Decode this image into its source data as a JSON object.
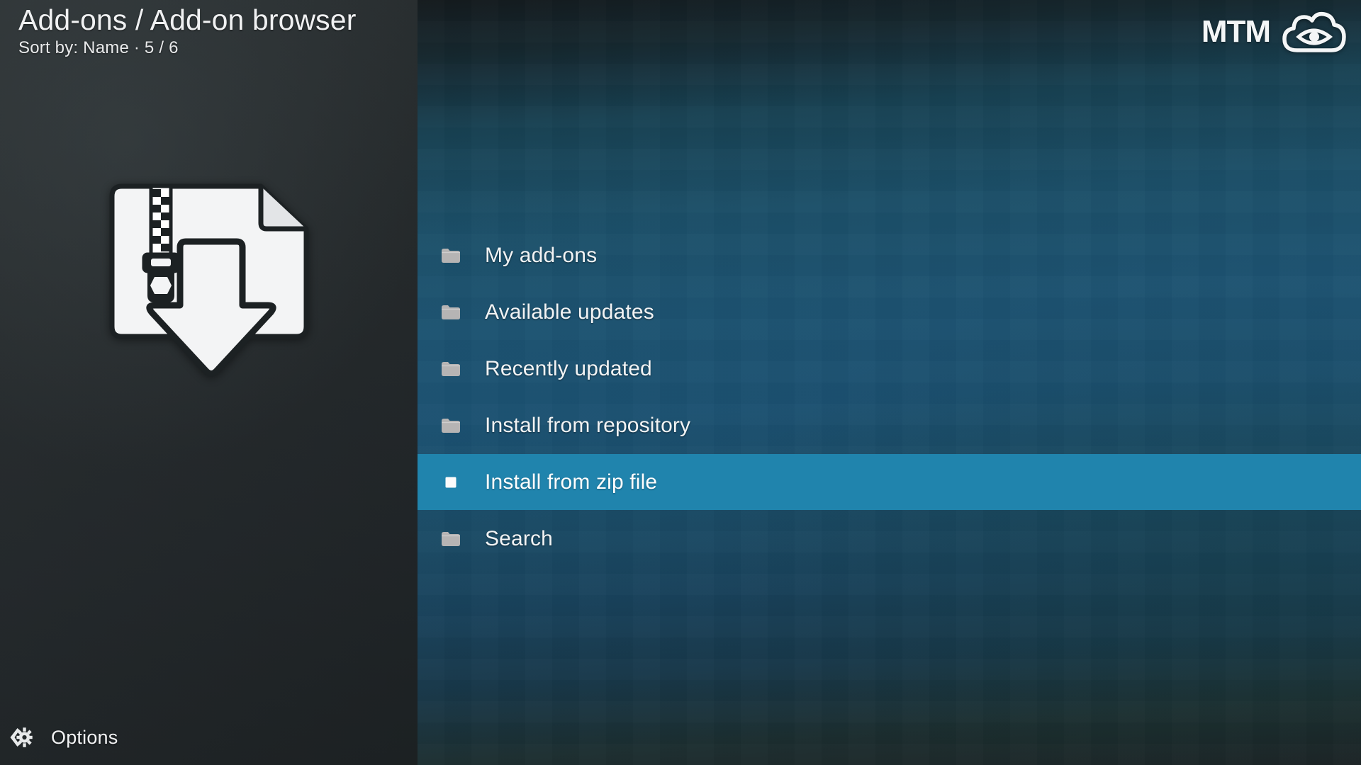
{
  "header": {
    "title": "Add-ons / Add-on browser",
    "subtitle": "Sort by: Name  ·  5 / 6",
    "sort_label": "Sort by:",
    "sort_value": "Name",
    "position": "5 / 6"
  },
  "branding": {
    "logo_text": "MTM",
    "logo_icon": "cloud-eye-icon"
  },
  "artwork": {
    "icon": "zip-file-download-icon"
  },
  "menu": {
    "items": [
      {
        "label": "My add-ons",
        "icon": "folder-icon",
        "selected": false
      },
      {
        "label": "Available updates",
        "icon": "folder-icon",
        "selected": false
      },
      {
        "label": "Recently updated",
        "icon": "folder-icon",
        "selected": false
      },
      {
        "label": "Install from repository",
        "icon": "folder-icon",
        "selected": false
      },
      {
        "label": "Install from zip file",
        "icon": "file-icon",
        "selected": true
      },
      {
        "label": "Search",
        "icon": "folder-icon",
        "selected": false
      }
    ],
    "selected_index": 4
  },
  "footer": {
    "options_label": "Options",
    "options_icon": "chevron-gear-icon"
  },
  "colors": {
    "highlight": "#2084ad",
    "sidebar_bg": "#262b2d",
    "panel_mid": "#1c5270",
    "text": "#f1f3f4",
    "icon_gray": "#b9b9b9"
  }
}
